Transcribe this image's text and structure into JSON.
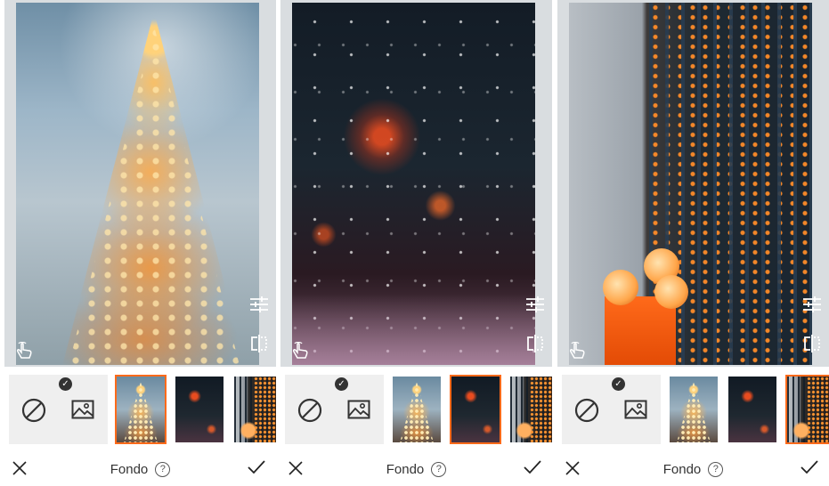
{
  "panels": [
    {
      "title": "Fondo",
      "help": "?",
      "selected_filter": 2
    },
    {
      "title": "Fondo",
      "help": "?",
      "selected_filter": 3
    },
    {
      "title": "Fondo",
      "help": "?",
      "selected_filter": 4
    }
  ],
  "accent_color": "#ff6a1a",
  "icons": {
    "close": "close-icon",
    "confirm": "checkmark-icon",
    "none": "prohibited-icon",
    "background": "image-icon",
    "adjust": "sliders-icon",
    "compare": "compare-split-icon",
    "touch": "hand-pointer-icon",
    "badge": "check-badge-icon",
    "help": "help-circle-icon"
  },
  "badge_glyph": "✓"
}
